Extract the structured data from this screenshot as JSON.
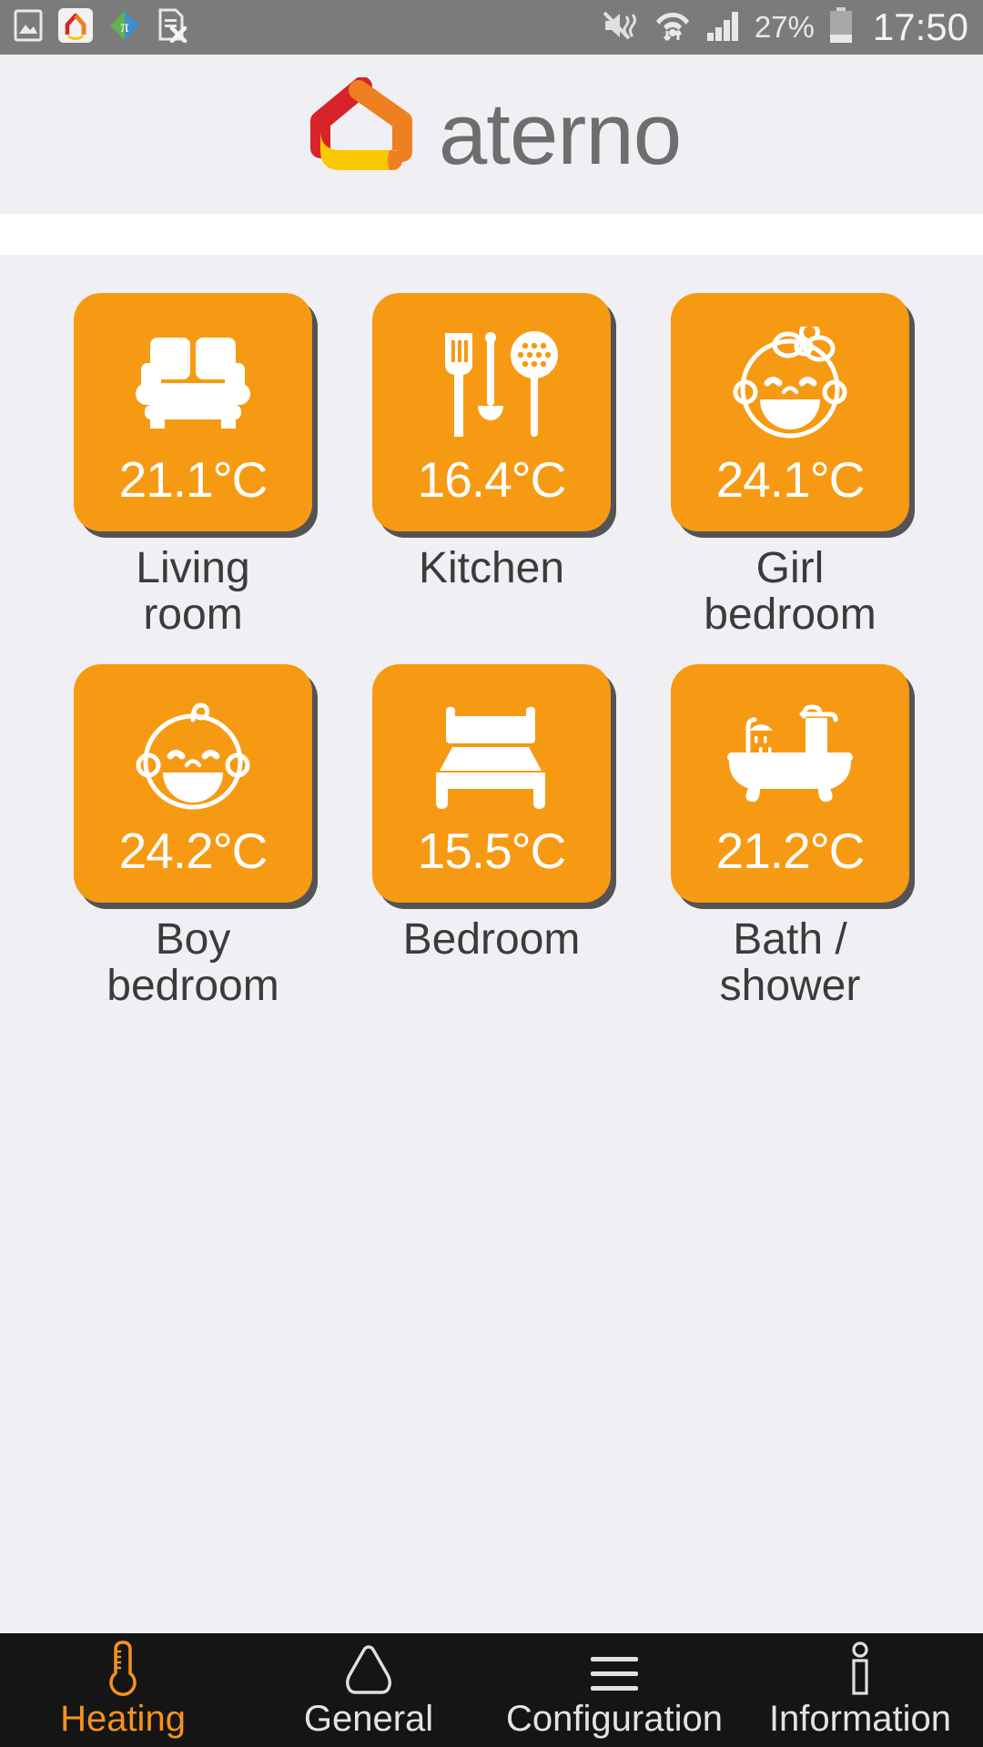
{
  "status_bar": {
    "background_color": "#7b7b7b",
    "left_icons": [
      {
        "name": "gallery-image-icon",
        "label": "Gallery"
      },
      {
        "name": "aterno-app-icon",
        "label": "aterno"
      },
      {
        "name": "multi-window-icon",
        "label": "Multi window"
      },
      {
        "name": "no-sim-card-icon",
        "label": "No SIM card"
      }
    ],
    "right_icons": [
      {
        "name": "mute-vibrate-icon",
        "label": "Sound muted"
      },
      {
        "name": "wifi-icon",
        "label": "Wi-Fi connected"
      },
      {
        "name": "cellular-signal-icon",
        "label": "Signal strength"
      }
    ],
    "battery_percent": "27%",
    "time": "17:50"
  },
  "header": {
    "logo_text": "aterno",
    "logo_colors": {
      "red": "#d8232a",
      "orange": "#ef8021",
      "yellow": "#f9c800",
      "text_gray": "#6e6e6e"
    },
    "background_color": "#f0f0f4"
  },
  "theme": {
    "tile_orange": "#f79a13",
    "accent_orange": "#f5921e",
    "page_background": "#f0f0f4",
    "nav_background": "#151515",
    "label_gray": "#3b3b3b"
  },
  "rooms": [
    {
      "id": "living-room",
      "icon": "sofa-icon",
      "temperature": "21.1°C",
      "label": "Living\nroom"
    },
    {
      "id": "kitchen",
      "icon": "utensils-icon",
      "temperature": "16.4°C",
      "label": "Kitchen"
    },
    {
      "id": "girl-bedroom",
      "icon": "baby-girl-icon",
      "temperature": "24.1°C",
      "label": "Girl\nbedroom"
    },
    {
      "id": "boy-bedroom",
      "icon": "baby-boy-icon",
      "temperature": "24.2°C",
      "label": "Boy\nbedroom"
    },
    {
      "id": "bedroom",
      "icon": "bed-icon",
      "temperature": "15.5°C",
      "label": "Bedroom"
    },
    {
      "id": "bath-shower",
      "icon": "bathtub-icon",
      "temperature": "21.2°C",
      "label": "Bath /\nshower"
    }
  ],
  "bottom_nav": {
    "items": [
      {
        "id": "heating",
        "icon": "thermometer-icon",
        "label": "Heating",
        "active": true
      },
      {
        "id": "general",
        "icon": "house-outline-icon",
        "label": "General",
        "active": false
      },
      {
        "id": "configuration",
        "icon": "hamburger-menu-icon",
        "label": "Configuration",
        "active": false
      },
      {
        "id": "information",
        "icon": "info-icon",
        "label": "Information",
        "active": false
      }
    ]
  }
}
